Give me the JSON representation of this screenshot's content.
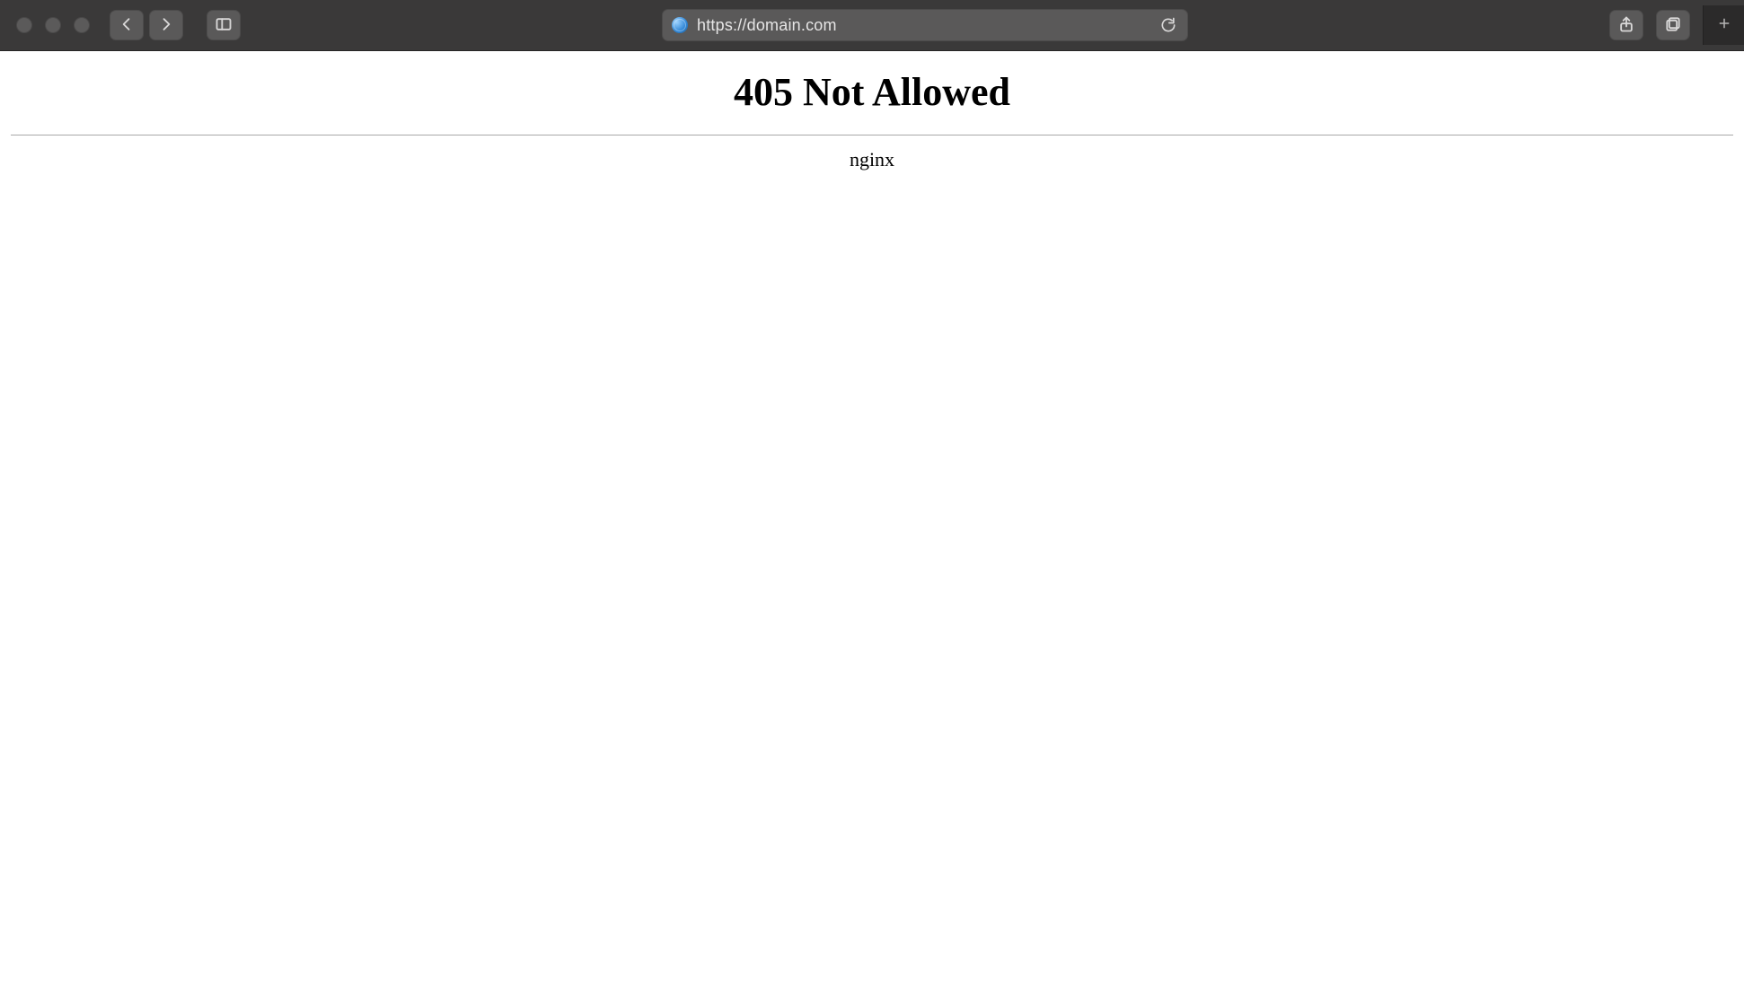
{
  "toolbar": {
    "url": "https://domain.com"
  },
  "page": {
    "heading": "405 Not Allowed",
    "server": "nginx"
  }
}
